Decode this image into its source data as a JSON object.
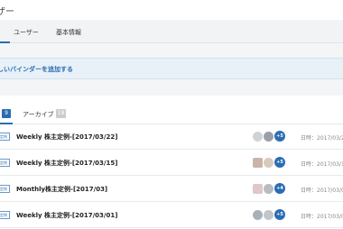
{
  "header": {
    "title": "ザー"
  },
  "tabs": {
    "users_label": "ユーザー",
    "basic_label": "基本情報"
  },
  "notice": {
    "add_binder_label": "しいバインダーを追加する"
  },
  "subtabs": {
    "active_count": "9",
    "archive_label": "アーカイブ",
    "archive_count": "18"
  },
  "rows": [
    {
      "type": "定例",
      "title": "Weekly 株主定例-[2017/03/22]",
      "more": "+5",
      "date": "日時：2017/03/2"
    },
    {
      "type": "定例",
      "title": "Weekly 株主定例-[2017/03/15]",
      "more": "+5",
      "date": "日時：2017/03/1"
    },
    {
      "type": "定例",
      "title": "Monthly株主定例-[2017/03]",
      "more": "+4",
      "date": "日時：2017/03/0"
    },
    {
      "type": "定例",
      "title": "Weekly 株主定例-[2017/03/01]",
      "more": "+5",
      "date": "日時：2017/03/0"
    }
  ],
  "colors": {
    "accent": "#2a6db3"
  }
}
